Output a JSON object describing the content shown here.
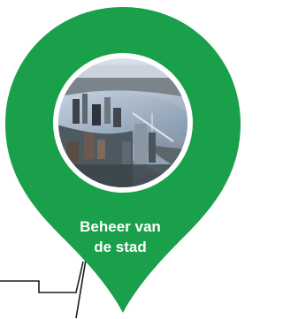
{
  "pin": {
    "label_lines": [
      "Beheer van",
      "de stad"
    ],
    "pin_color": "#1aa04a",
    "label_color": "#ffffff",
    "photo_ring_color": "#ffffff",
    "connector_color": "#1d1d1b",
    "photo_subject": "aerial-city-skyline-with-river"
  }
}
